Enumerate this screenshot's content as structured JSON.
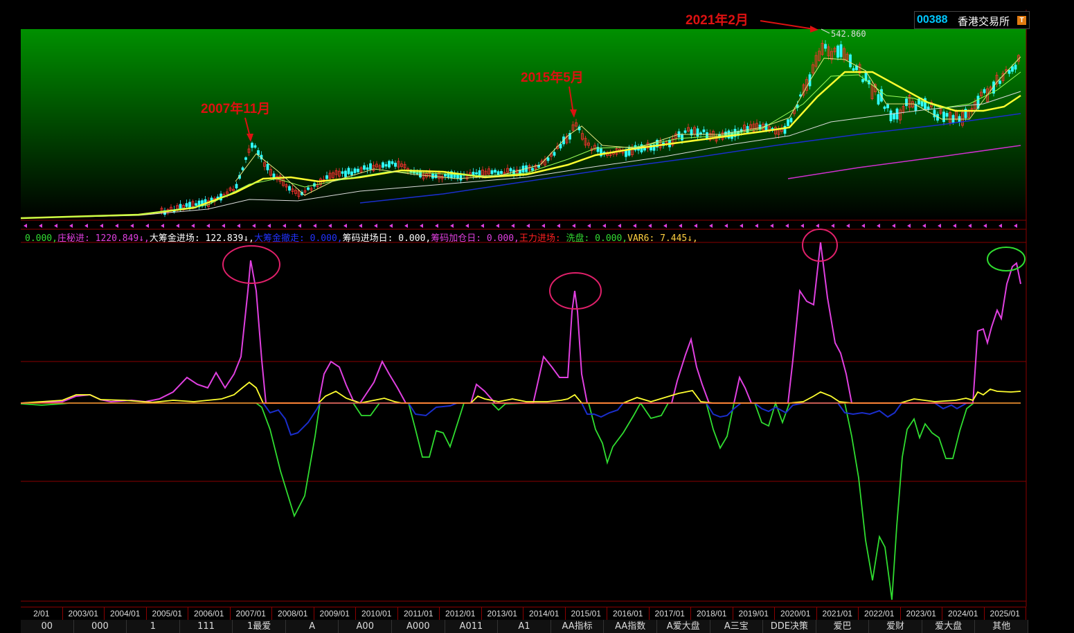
{
  "header": {
    "code": "00388",
    "name": "香港交易所",
    "badge": "T"
  },
  "annotations": {
    "a2007": "2007年11月",
    "a2015": "2015年5月",
    "a2021": "2021年2月",
    "peak_value": "542.860"
  },
  "legend": {
    "items": [
      {
        "text": "0.000,",
        "color": "#33dd33"
      },
      {
        "text": "庄秘进: 1220.849↓,",
        "color": "#e040e0"
      },
      {
        "text": "大筹金进场: 122.839↓,",
        "color": "#ffffff"
      },
      {
        "text": "大筹金撤走: 0.000,",
        "color": "#2233ff"
      },
      {
        "text": "筹码进场日: 0.000,",
        "color": "#ffffff"
      },
      {
        "text": "筹码加仓日: 0.000,",
        "color": "#e040e0"
      },
      {
        "text": "王力进场: ",
        "color": "#ff2020"
      },
      {
        "text": "洗盘: 0.000,",
        "color": "#33dd33"
      },
      {
        "text": "VAR6: 7.445↓,",
        "color": "#ffd040"
      }
    ]
  },
  "dates": [
    "2/01",
    "2003/01",
    "2004/01",
    "2005/01",
    "2006/01",
    "2007/01",
    "2008/01",
    "2009/01",
    "2010/01",
    "2011/01",
    "2012/01",
    "2013/01",
    "2014/01",
    "2015/01",
    "2016/01",
    "2017/01",
    "2018/01",
    "2019/01",
    "2020/01",
    "2021/01",
    "2022/01",
    "2023/01",
    "2024/01",
    "2025/01"
  ],
  "tabs": [
    "00",
    "000",
    "1",
    "111",
    "1最爱",
    "A",
    "A00",
    "A000",
    "A011",
    "A1",
    "AA指标",
    "AA指数",
    "A爱大盘",
    "A三宝",
    "DDE决策",
    "爱巴",
    "爱财",
    "爱大盘",
    "其他"
  ],
  "colors": {
    "up": "#ff3030",
    "down": "#30ffff",
    "ma_main": "#ffff30",
    "accent_red": "#dd1111"
  }
}
